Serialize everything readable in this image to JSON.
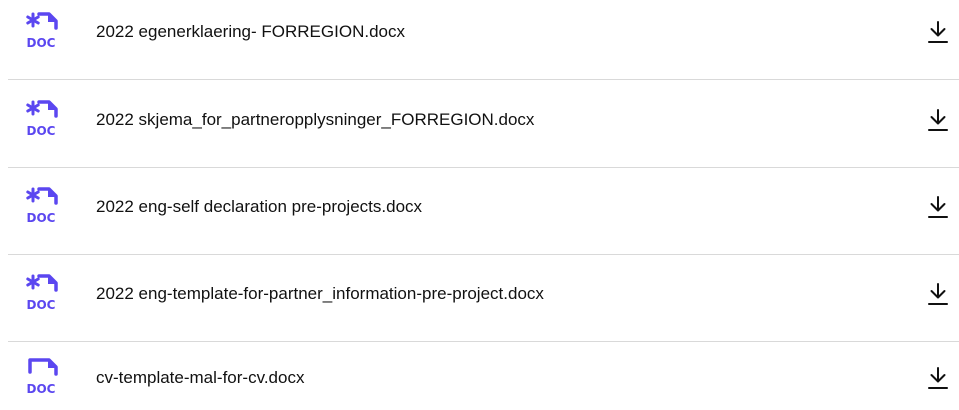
{
  "accent_color": "#5b47f0",
  "files": [
    {
      "name": "2022 egenerklaering- FORREGION.docx",
      "icon": "doc-file-asterisk-icon",
      "icon_label": "DOC",
      "action_icon": "download-icon"
    },
    {
      "name": "2022 skjema_for_partneropplysninger_FORREGION.docx",
      "icon": "doc-file-asterisk-icon",
      "icon_label": "DOC",
      "action_icon": "download-icon"
    },
    {
      "name": "2022 eng-self declaration pre-projects.docx",
      "icon": "doc-file-asterisk-icon",
      "icon_label": "DOC",
      "action_icon": "download-icon"
    },
    {
      "name": "2022 eng-template-for-partner_information-pre-project.docx",
      "icon": "doc-file-asterisk-icon",
      "icon_label": "DOC",
      "action_icon": "download-icon"
    },
    {
      "name": "cv-template-mal-for-cv.docx",
      "icon": "doc-file-icon",
      "icon_label": "DOC",
      "action_icon": "download-icon"
    }
  ]
}
